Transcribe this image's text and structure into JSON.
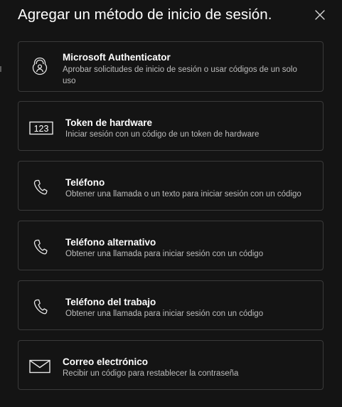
{
  "dialog": {
    "title": "Agregar un método de inicio de sesión."
  },
  "methods": [
    {
      "name": "Microsoft Authenticator",
      "description": "Aprobar solicitudes de inicio de sesión o usar códigos de un solo uso",
      "icon": "authenticator-lock-icon"
    },
    {
      "name": "Token de hardware",
      "description": "Iniciar sesión con un código de un token de hardware",
      "icon": "hardware-token-icon",
      "icon_text": "123"
    },
    {
      "name": "Teléfono",
      "description": "Obtener una llamada o un texto para iniciar sesión con un código",
      "icon": "phone-icon"
    },
    {
      "name": "Teléfono alternativo",
      "description": "Obtener una llamada para iniciar sesión con un código",
      "icon": "phone-icon"
    },
    {
      "name": "Teléfono del trabajo",
      "description": "Obtener una llamada para iniciar sesión con un código",
      "icon": "phone-icon"
    },
    {
      "name": "Correo electrónico",
      "description": "Recibir un código para restablecer la contraseña",
      "icon": "mail-icon"
    }
  ],
  "colors": {
    "background": "#141414",
    "card_border": "#3a3a3a",
    "text_primary": "#ffffff",
    "text_secondary": "#bdbdbd"
  }
}
